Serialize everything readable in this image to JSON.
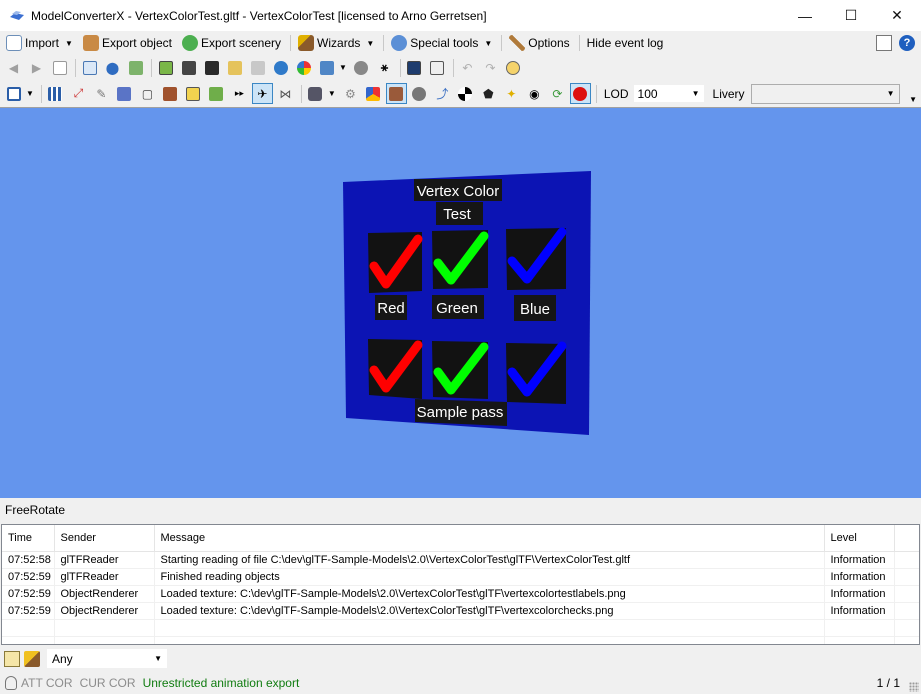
{
  "window": {
    "title": "ModelConverterX - VertexColorTest.gltf - VertexColorTest [licensed to Arno Gerretsen]",
    "minimize_glyph": "—",
    "maximize_glyph": "☐",
    "close_glyph": "✕"
  },
  "menu": {
    "import": "Import",
    "export_object": "Export object",
    "export_scenery": "Export scenery",
    "wizards": "Wizards",
    "special_tools": "Special tools",
    "options": "Options",
    "hide_event_log": "Hide event log"
  },
  "toolbar3": {
    "lod_label": "LOD",
    "lod_value": "100",
    "livery_label": "Livery",
    "livery_value": ""
  },
  "viewport": {
    "background": "#6495ed",
    "panel_color": "#0c14b4",
    "title_line1": "Vertex Color",
    "title_line2": "Test",
    "labels": [
      "Red",
      "Green",
      "Blue"
    ],
    "footer": "Sample pass",
    "check_colors": [
      "#ff0000",
      "#00ff00",
      "#0000ff"
    ]
  },
  "mode": "FreeRotate",
  "log": {
    "columns": [
      "Time",
      "Sender",
      "Message",
      "Level"
    ],
    "rows": [
      [
        "07:52:58",
        "glTFReader",
        "Starting reading of file C:\\dev\\glTF-Sample-Models\\2.0\\VertexColorTest\\glTF\\VertexColorTest.gltf",
        "Information"
      ],
      [
        "07:52:59",
        "glTFReader",
        "Finished reading objects",
        "Information"
      ],
      [
        "07:52:59",
        "ObjectRenderer",
        "Loaded texture: C:\\dev\\glTF-Sample-Models\\2.0\\VertexColorTest\\glTF\\vertexcolortestlabels.png",
        "Information"
      ],
      [
        "07:52:59",
        "ObjectRenderer",
        "Loaded texture: C:\\dev\\glTF-Sample-Models\\2.0\\VertexColorTest\\glTF\\vertexcolorchecks.png",
        "Information"
      ]
    ]
  },
  "filter": {
    "value": "Any"
  },
  "status": {
    "att": "ATT COR",
    "cur": "CUR COR",
    "message": "Unrestricted animation export",
    "page": "1 / 1"
  }
}
